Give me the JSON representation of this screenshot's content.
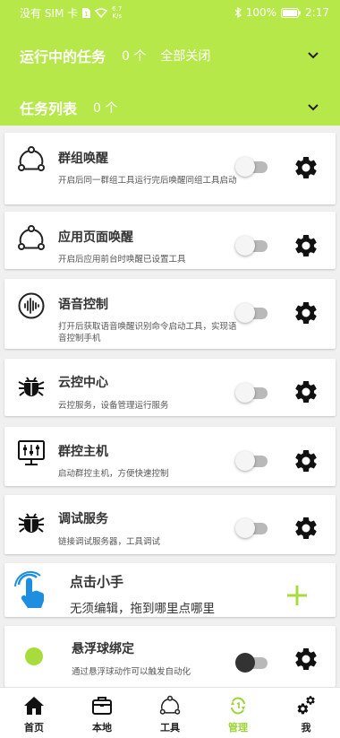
{
  "status_bar": {
    "carrier": "没有 SIM 卡",
    "speed_value": "6.7",
    "speed_unit": "K/s",
    "battery": "100%",
    "time": "2:17"
  },
  "running": {
    "title": "运行中的任务",
    "count": "0 个",
    "close_all": "全部关闭"
  },
  "task_list": {
    "title": "任务列表",
    "count": "0 个"
  },
  "cards": [
    {
      "title": "群组唤醒",
      "desc": "开启后同一群组工具运行完后唤醒同组工具启动",
      "icon": "share-nodes-icon",
      "enabled": false
    },
    {
      "title": "应用页面唤醒",
      "desc": "开启后应用前台时唤醒已设置工具",
      "icon": "share-nodes-icon",
      "enabled": false
    },
    {
      "title": "语音控制",
      "desc": "打开后获取语音唤醒识别命令启动工具，实现语音控制手机",
      "icon": "voice-wave-icon",
      "enabled": false
    },
    {
      "title": "云控中心",
      "desc": "云控服务，设备管理运行服务",
      "icon": "bug-icon",
      "enabled": false
    },
    {
      "title": "群控主机",
      "desc": "启动群控主机，方便快速控制",
      "icon": "monitor-sliders-icon",
      "enabled": false
    },
    {
      "title": "调试服务",
      "desc": "链接调试服务器，工具调试",
      "icon": "bug-icon",
      "enabled": false
    },
    {
      "title": "点击小手",
      "desc": "无须编辑，拖到哪里点哪里",
      "icon": "tap-hand-icon"
    },
    {
      "title": "悬浮球绑定",
      "desc": "通过悬浮球动作可以触发自动化",
      "icon": "green-dot-icon",
      "enabled": true
    }
  ],
  "tabs": [
    {
      "label": "首页",
      "icon": "home-icon",
      "active": false
    },
    {
      "label": "本地",
      "icon": "briefcase-icon",
      "active": false
    },
    {
      "label": "工具",
      "icon": "share-nodes-icon",
      "active": false
    },
    {
      "label": "管理",
      "icon": "refresh-icon",
      "active": true
    },
    {
      "label": "我",
      "icon": "gears-icon",
      "active": false
    }
  ],
  "colors": {
    "accent": "#b7e84a",
    "active_tab": "#9cd43a",
    "plus": "#a8dc3c"
  }
}
